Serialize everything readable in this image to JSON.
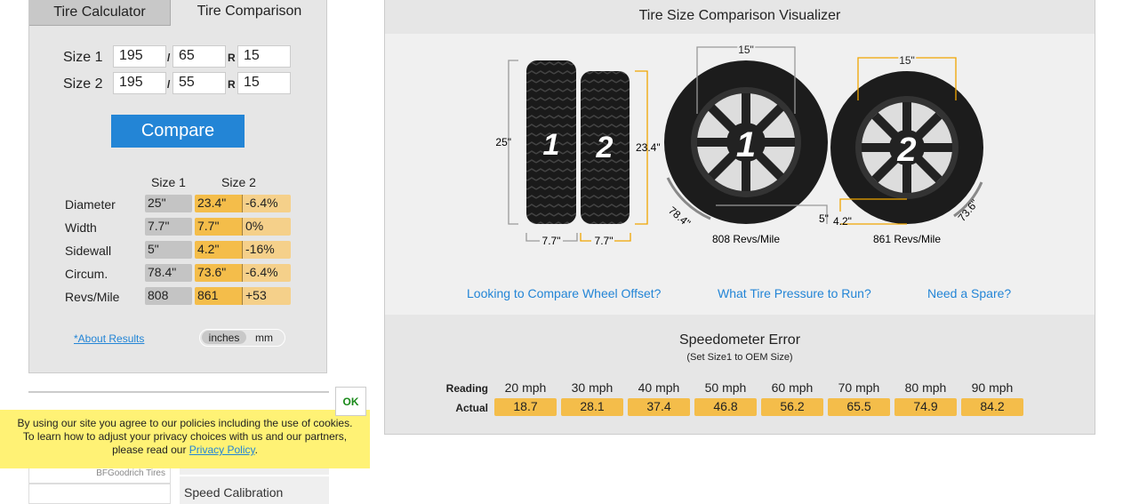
{
  "tabs": {
    "calculator": "Tire Calculator",
    "comparison": "Tire Comparison"
  },
  "sizes": [
    {
      "label": "Size 1",
      "width": "195",
      "aspect": "65",
      "rim": "15"
    },
    {
      "label": "Size 2",
      "width": "195",
      "aspect": "55",
      "rim": "15"
    }
  ],
  "separators": {
    "slash": "/",
    "r": "R"
  },
  "compare_label": "Compare",
  "results": {
    "headers": [
      "Size 1",
      "Size 2"
    ],
    "rows": [
      {
        "label": "Diameter",
        "s1": "25\"",
        "s2": "23.4\"",
        "diff": "-6.4%"
      },
      {
        "label": "Width",
        "s1": "7.7\"",
        "s2": "7.7\"",
        "diff": "0%"
      },
      {
        "label": "Sidewall",
        "s1": "5\"",
        "s2": "4.2\"",
        "diff": "-16%"
      },
      {
        "label": "Circum.",
        "s1": "78.4\"",
        "s2": "73.6\"",
        "diff": "-6.4%"
      },
      {
        "label": "Revs/Mile",
        "s1": "808",
        "s2": "861",
        "diff": "+53"
      }
    ]
  },
  "about_link": "*About Results",
  "units": {
    "inches": "inches",
    "mm": "mm",
    "selected": "inches"
  },
  "visualizer": {
    "title": "Tire Size Comparison Visualizer",
    "tire1": {
      "num": "1",
      "diameter": "25\"",
      "width": "7.7\"",
      "rim": "15\"",
      "sidewall": "5\"",
      "circum": "78.4\"",
      "revs": "808 Revs/Mile"
    },
    "tire2": {
      "num": "2",
      "diameter": "23.4\"",
      "width": "7.7\"",
      "rim": "15\"",
      "sidewall": "4.2\"",
      "circum": "73.6\"",
      "revs": "861 Revs/Mile"
    },
    "colors": {
      "size1": "#999999",
      "size2": "#f0a500"
    }
  },
  "links": [
    "Looking to Compare Wheel Offset?",
    "What Tire Pressure to Run?",
    "Need a Spare?"
  ],
  "speedo": {
    "title": "Speedometer Error",
    "subtitle": "(Set Size1 to OEM Size)",
    "reading_label": "Reading",
    "actual_label": "Actual",
    "readings": [
      "20 mph",
      "30 mph",
      "40 mph",
      "50 mph",
      "60 mph",
      "70 mph",
      "80 mph",
      "90 mph"
    ],
    "actual": [
      "18.7",
      "28.1",
      "37.4",
      "46.8",
      "56.2",
      "65.5",
      "74.9",
      "84.2"
    ]
  },
  "cookie": {
    "ok": "OK",
    "line1": "By using our site you agree to our policies including the use of cookies.",
    "line2": "To learn how to adjust your privacy choices with us and our partners,",
    "line3": "please read our",
    "link": "Privacy Policy",
    "end": "."
  },
  "sidebar": {
    "brand_caption": "BFGoodrich Tires",
    "speed_calibration": "Speed Calibration"
  }
}
